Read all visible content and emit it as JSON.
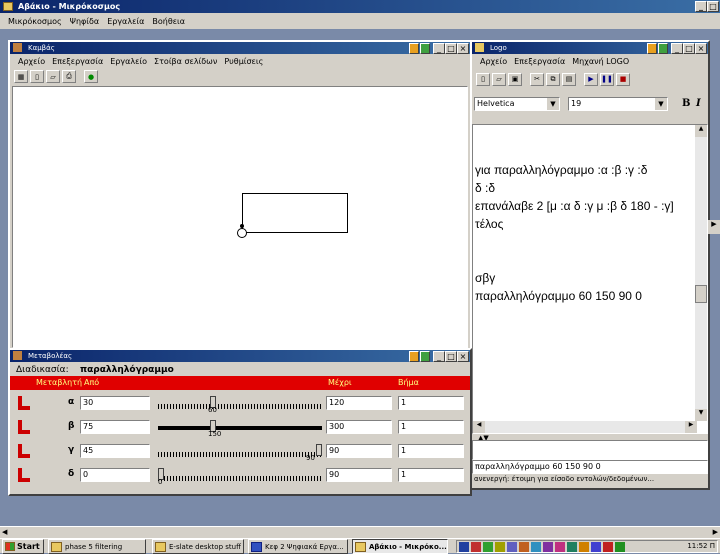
{
  "app": {
    "title": "Αβάκιο - Μικρόκοσμος",
    "menu": [
      "Μικρόκοσμος",
      "Ψηφίδα",
      "Εργαλεία",
      "Βοήθεια"
    ]
  },
  "canvas_window": {
    "title": "Καμβάς",
    "menu": [
      "Αρχείο",
      "Επεξεργασία",
      "Εργαλείο",
      "Στοίβα σελίδων",
      "Ρυθμίσεις"
    ]
  },
  "logo_window": {
    "title": "Logo",
    "menu": [
      "Αρχείο",
      "Επεξεργασία",
      "Μηχανή LOGO"
    ],
    "font_name": "Helvetica",
    "font_size": "19",
    "bold": "B",
    "italic": "I",
    "code_lines": [
      "για παραλληλόγραμμο :α :β :γ :δ",
      "δ :δ",
      "επανάλαβε 2 [μ :α δ :γ μ :β δ 180 - :γ]",
      "τέλος",
      "",
      "",
      "σβγ",
      "παραλληλόγραμμο 60 150 90 0"
    ],
    "command_input": "παραλληλόγραμμο 60 150 90 0",
    "status": "ανενεργή: έτοιμη για είσοδο εντολών/δεδομένων..."
  },
  "variables_window": {
    "title": "Μεταβολέας",
    "procedure_label": "Διαδικασία:",
    "procedure_name": "παραλληλόγραμμο",
    "headers": {
      "var": "Μεταβλητή",
      "from": "Από",
      "to": "Μέχρι",
      "step": "Βήμα"
    },
    "rows": [
      {
        "name": "α",
        "from": "30",
        "to": "120",
        "step": "1",
        "value": "60",
        "fraction": 0.33
      },
      {
        "name": "β",
        "from": "75",
        "to": "300",
        "step": "1",
        "value": "150",
        "fraction": 0.33
      },
      {
        "name": "γ",
        "from": "45",
        "to": "90",
        "step": "1",
        "value": "90",
        "fraction": 1.0
      },
      {
        "name": "δ",
        "from": "0",
        "to": "90",
        "step": "1",
        "value": "0",
        "fraction": 0.0
      }
    ]
  },
  "taskbar": {
    "start": "Start",
    "tasks": [
      "phase 5 filtering",
      "E-slate desktop stuff",
      "Κεφ 2 Ψηφιακά Εργα...",
      "Αβάκιο - Μικρόκο..."
    ],
    "clock": "11:52 Π"
  }
}
